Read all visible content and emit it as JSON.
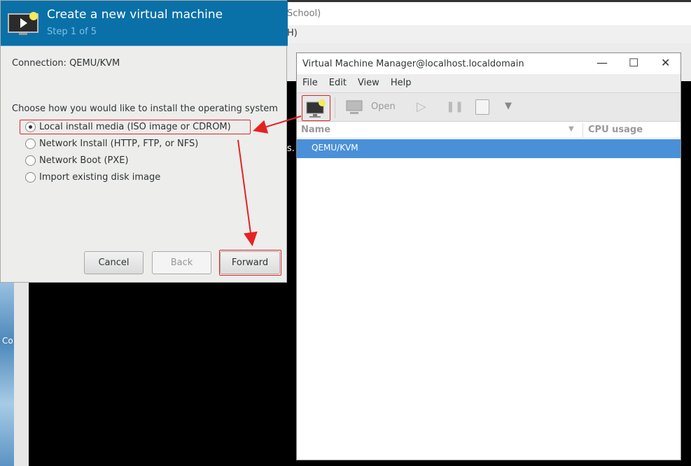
{
  "background": {
    "window_title_fragment": "School)",
    "menu_fragment": "H)",
    "terminal_fragment": "s.",
    "desktop_label_fragment": "Co"
  },
  "dialog": {
    "title": "Create a new virtual machine",
    "step": "Step 1 of 5",
    "connection": "Connection: QEMU/KVM",
    "prompt": "Choose how you would like to install the operating system",
    "options": [
      {
        "label": "Local install media (ISO image or CDROM)",
        "selected": true
      },
      {
        "label": "Network Install (HTTP, FTP, or NFS)",
        "selected": false
      },
      {
        "label": "Network Boot (PXE)",
        "selected": false
      },
      {
        "label": "Import existing disk image",
        "selected": false
      }
    ],
    "buttons": {
      "cancel": "Cancel",
      "back": "Back",
      "forward": "Forward"
    }
  },
  "vmm": {
    "title": "Virtual Machine Manager@localhost.localdomain",
    "menu": [
      "File",
      "Edit",
      "View",
      "Help"
    ],
    "toolbar": {
      "open": "Open"
    },
    "columns": [
      "Name",
      "CPU usage"
    ],
    "rows": [
      "QEMU/KVM"
    ]
  },
  "colors": {
    "header": "#0a70a8",
    "selection": "#4a90d9",
    "annotation": "#e52222"
  }
}
